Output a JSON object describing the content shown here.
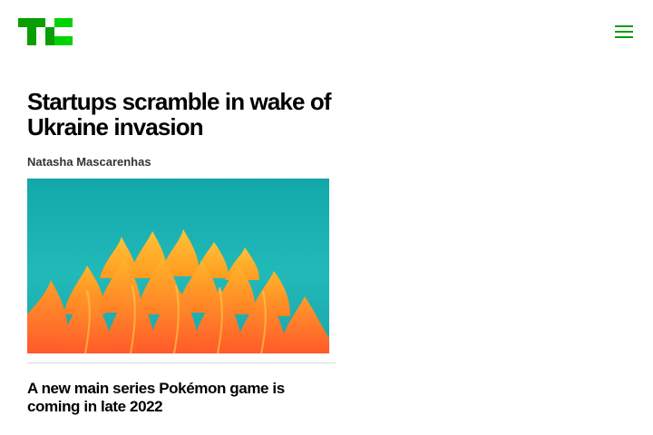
{
  "header": {
    "logo_icon": "techcrunch-logo-icon",
    "menu_icon": "hamburger-menu-icon",
    "brand_color": "#0a9e01",
    "brand_color_light": "#00d301"
  },
  "article": {
    "title": "Startups scramble in wake of Ukraine invasion",
    "author": "Natasha Mascarenhas",
    "image": "orange-paper-flames-on-teal-background"
  },
  "related": {
    "title": "A new main series Pokémon game is coming in late 2022"
  },
  "colors": {
    "image_background": "#1fb3b5",
    "flame_orange": "#ff7a2e",
    "flame_yellow": "#ffb020",
    "divider": "#d9d9d9"
  }
}
